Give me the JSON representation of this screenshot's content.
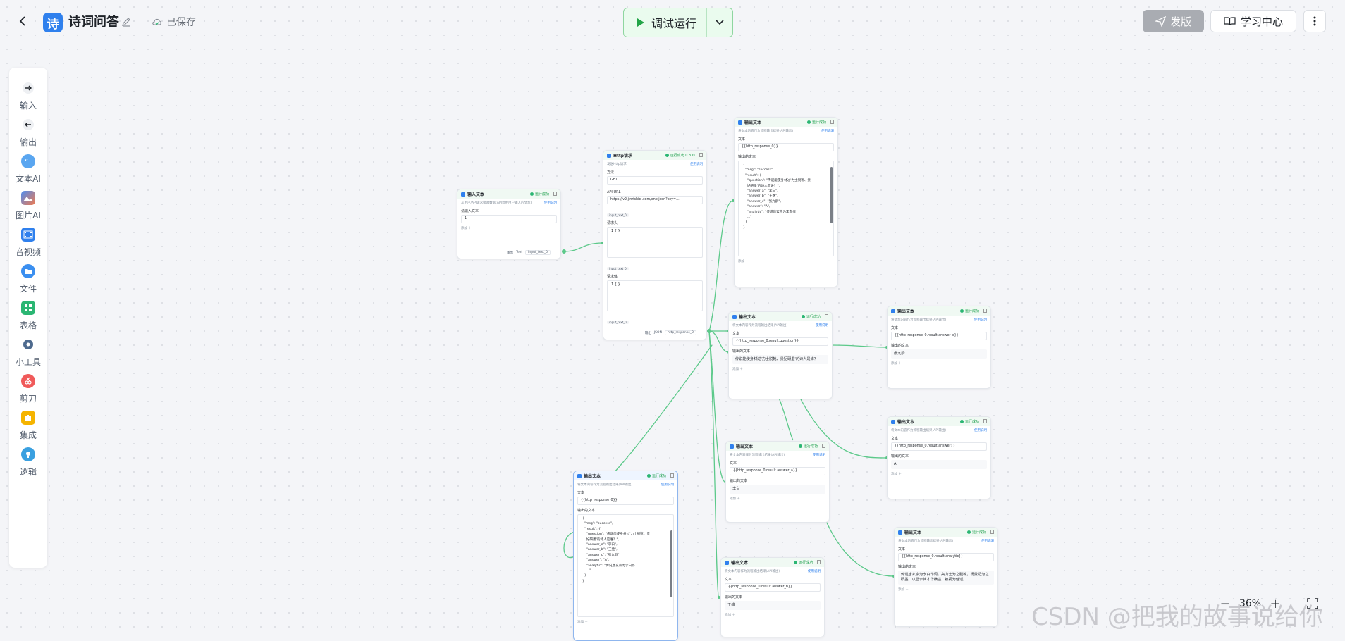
{
  "header": {
    "app_icon_char": "诗",
    "title": "诗词问答",
    "saved_label": "已保存",
    "run_label": "调试运行",
    "publish_label": "发版",
    "learn_label": "学习中心"
  },
  "sidebar": {
    "items": [
      {
        "label": "输入",
        "icon": "arrow-right-icon"
      },
      {
        "label": "输出",
        "icon": "arrow-left-icon"
      },
      {
        "label": "文本AI",
        "icon": "chat-icon"
      },
      {
        "label": "图片AI",
        "icon": "image-icon"
      },
      {
        "label": "音视频",
        "icon": "film-icon"
      },
      {
        "label": "文件",
        "icon": "folder-icon"
      },
      {
        "label": "表格",
        "icon": "table-icon"
      },
      {
        "label": "小工具",
        "icon": "gear-icon"
      },
      {
        "label": "剪刀",
        "icon": "scissors-icon"
      },
      {
        "label": "集成",
        "icon": "puzzle-icon"
      },
      {
        "label": "逻辑",
        "icon": "bulb-icon"
      }
    ]
  },
  "colors": {
    "accent": "#2f80ed",
    "success": "#2bb673",
    "edge": "#5cc98a"
  },
  "common": {
    "status_ok": "运行成功",
    "add_label": "添加 ＋",
    "output_text_label": "输出的文本",
    "text_label": "文本",
    "usage_link": "使用说明",
    "output_desc": "将文本内容作为流程输出结果(API输出)"
  },
  "nodes": {
    "input": {
      "title": "输入文本",
      "desc": "从用户/API请求接收数据(API调用用户输入的文本)",
      "field_label": "请输入文本",
      "value": "1",
      "out_label": "输出",
      "out_type": "Text",
      "out_var": "input_text_0"
    },
    "http": {
      "title": "Http请求",
      "status": "运行成功 0.33s",
      "desc": "发送Http请求",
      "method_label": "方法",
      "method": "GET",
      "url_label": "API URL",
      "url": "https://v2.jinrishici.com/one.json?key=...",
      "var_tag": "input_text_0",
      "header_label": "请求头",
      "header_code": "1  { }",
      "body_label": "请求体",
      "body_code": "1  { }",
      "out_label": "输出",
      "out_type": "JSON",
      "out_var": "http_response_0"
    },
    "out_top": {
      "title": "输出文本",
      "text_value": "{{http_response_0}}",
      "json_text": "{\n  \"msg\": \"success\",\n  \"result\": {\n    \"question\": \"传说能使身材过'力士脱靴、贵\n    妃研墨'的诗人是谁？\",\n    \"answer_a\": \"李白\",\n    \"answer_b\": \"王维\",\n    \"answer_c\": \"张九龄\",\n    \"answer\": \"A\",\n    \"analytic\": \"传说唐玄宗为李白作\n    ...\"\n  }\n}"
    },
    "out_question": {
      "title": "输出文本",
      "text_value": "{{http_response_0.result.question}}",
      "output_value": "传说能使身材过'力士脱靴、贵妃研墨'的诗人是谁？"
    },
    "out_answer_c": {
      "title": "输出文本",
      "text_value": "{{http_response_0.result.answer_c}}",
      "output_value": "张九龄"
    },
    "out_answer": {
      "title": "输出文本",
      "text_value": "{{http_response_0.result.answer}}",
      "output_value": "A"
    },
    "out_answer_a": {
      "title": "输出文本",
      "text_value": "{{http_response_0.result.answer_a}}",
      "output_value": "李白"
    },
    "out_bottom": {
      "title": "输出文本",
      "text_value": "{{http_response_0}}",
      "json_text": "{\n  \"msg\": \"success\",\n  \"result\": {\n    \"question\": \"传说能使身材过'力士脱靴、贵\n    妃研墨'的诗人是谁？\",\n    \"answer_a\": \"李白\",\n    \"answer_b\": \"王维\",\n    \"answer_c\": \"张九龄\",\n    \"answer\": \"A\",\n    \"analytic\": \"传说唐玄宗为李白作\n    ...\"\n  }\n}"
    },
    "out_analytic": {
      "title": "输出文本",
      "text_value": "{{http_response_0.result.analytic}}",
      "output_value": "传说唐玄宗为李白作词，高力士为之脱靴，杨贵妃为之研墨，以显示其才华横溢，被视为佳话。"
    },
    "out_answer_b": {
      "title": "输出文本",
      "text_value": "{{http_response_0.result.answer_b}}",
      "output_value": "王维"
    }
  },
  "zoom": {
    "level": "36%"
  },
  "watermark": "CSDN @把我的故事说给你"
}
